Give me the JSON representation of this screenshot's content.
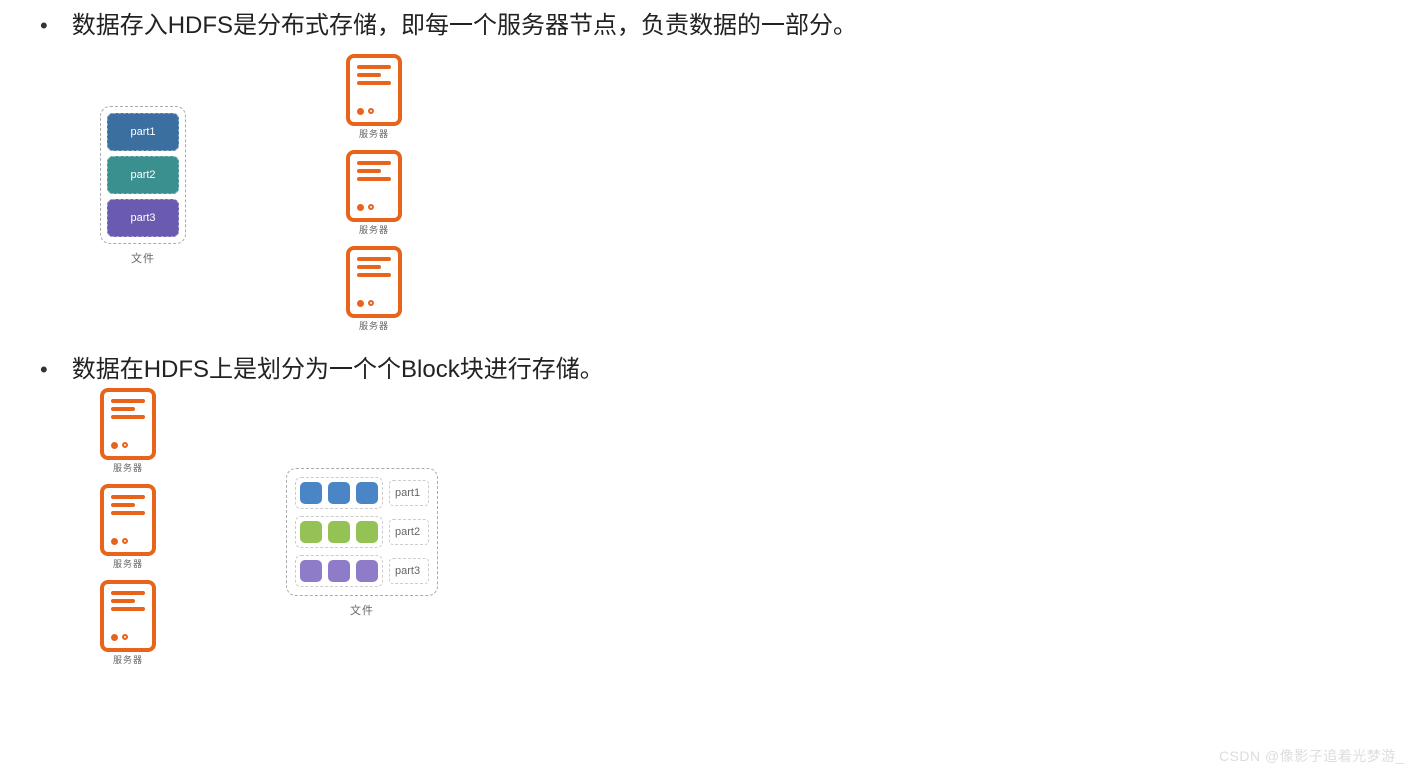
{
  "bullets": {
    "b1": "数据存入HDFS是分布式存储，即每一个服务器节点，负责数据的一部分。",
    "b2": "数据在HDFS上是划分为一个个Block块进行存储。"
  },
  "file": {
    "part1": "part1",
    "part2": "part2",
    "part3": "part3",
    "caption": "文件"
  },
  "server": {
    "caption": "服务器"
  },
  "blocks": {
    "row1_label": "part1",
    "row2_label": "part2",
    "row3_label": "part3",
    "caption": "文件"
  },
  "watermark": "CSDN @像影子追着光梦游_"
}
